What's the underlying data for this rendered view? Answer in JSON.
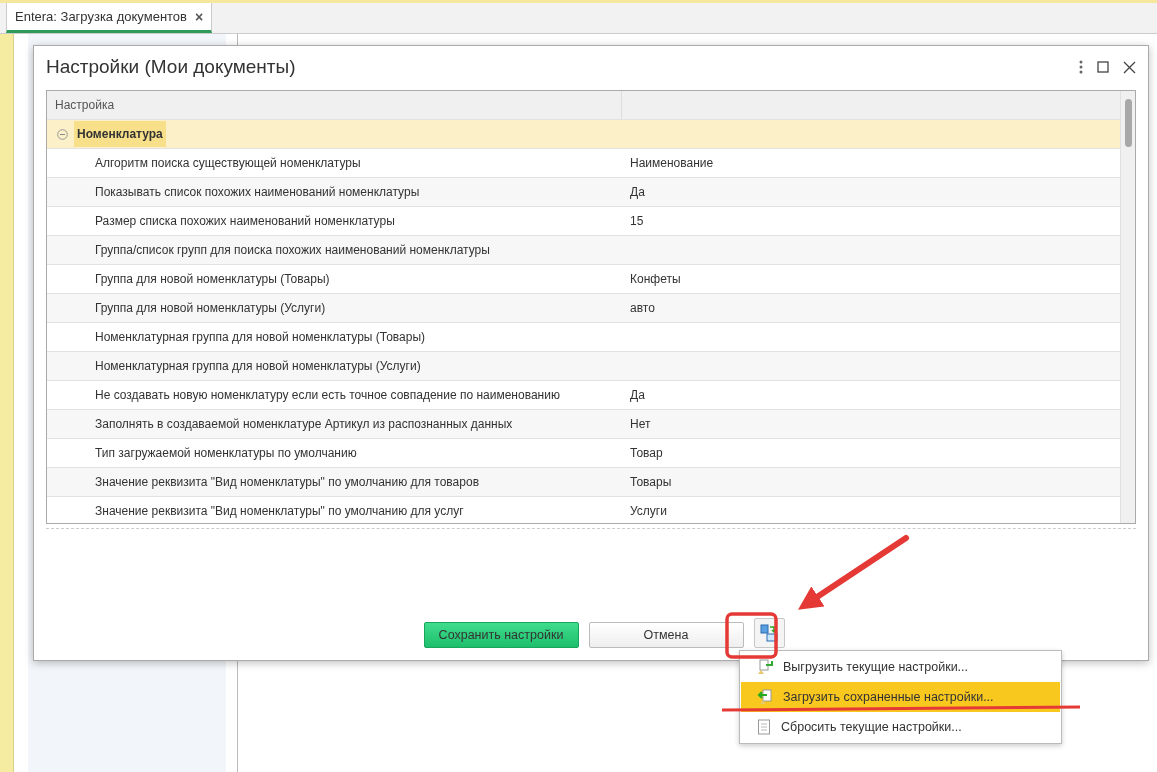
{
  "tabs": [
    {
      "label": "Entera: Загрузка документов",
      "close": "×",
      "selected": true
    }
  ],
  "dialog": {
    "title": "Настройки (Мои документы)",
    "table": {
      "columns": [
        "Настройка"
      ],
      "group": {
        "label": "Номенклатура",
        "expanded": true
      },
      "rows": [
        {
          "setting": "Алгоритм поиска существующей номенклатуры",
          "value": "Наименование"
        },
        {
          "setting": "Показывать список похожих наименований номенклатуры",
          "value": "Да"
        },
        {
          "setting": "Размер списка похожих наименований номенклатуры",
          "value": "15"
        },
        {
          "setting": "Группа/список групп для поиска похожих наименований номенклатуры"
        },
        {
          "setting": "Группа для новой номенклатуры (Товары)",
          "value": "Конфеты"
        },
        {
          "setting": "Группа для новой номенклатуры (Услуги)",
          "value": "авто"
        },
        {
          "setting": "Номенклатурная группа для новой номенклатуры (Товары)"
        },
        {
          "setting": "Номенклатурная группа для новой номенклатуры (Услуги)"
        },
        {
          "setting": "Не создавать новую номенклатуру если есть точное совпадение по наименованию",
          "value": "Да"
        },
        {
          "setting": "Заполнять в создаваемой номенклатуре Артикул из распознанных данных",
          "value": "Нет"
        },
        {
          "setting": "Тип загружаемой номенклатуры по умолчанию",
          "value": "Товар"
        },
        {
          "setting": "Значение реквизита \"Вид номенклатуры\" по умолчанию для товаров",
          "value": "Товары"
        },
        {
          "setting": "Значение реквизита \"Вид номенклатуры\" по умолчанию для услуг",
          "value": "Услуги"
        }
      ]
    },
    "buttons": [
      {
        "kind": "primary",
        "label": "Сохранить настройки"
      },
      {
        "kind": "secondary",
        "label": "Отмена"
      },
      {
        "kind": "icon"
      }
    ],
    "menu": {
      "items": [
        {
          "label": "Выгрузить текущие настройки...",
          "selected": false
        },
        {
          "label": "Загрузить сохраненные настройки...",
          "selected": true
        },
        {
          "label": "Сбросить текущие настройки...",
          "selected": false
        }
      ]
    }
  }
}
